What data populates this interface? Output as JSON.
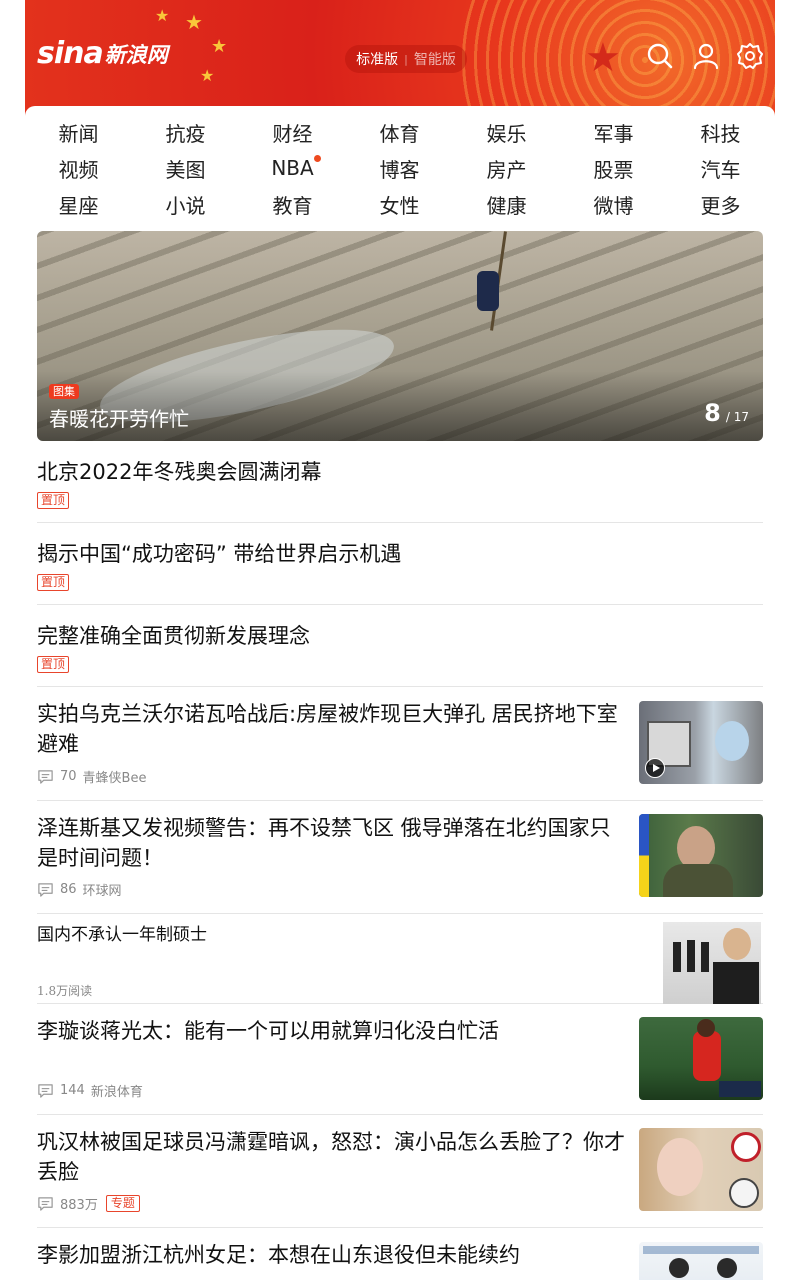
{
  "header": {
    "logo_text": "sina",
    "logo_cn": "新浪网",
    "mode_standard": "标准版",
    "mode_smart": "智能版",
    "icons": [
      "search-icon",
      "user-icon",
      "settings-icon"
    ]
  },
  "channels": [
    {
      "label": "新闻"
    },
    {
      "label": "抗疫"
    },
    {
      "label": "财经"
    },
    {
      "label": "体育"
    },
    {
      "label": "娱乐"
    },
    {
      "label": "军事"
    },
    {
      "label": "科技"
    },
    {
      "label": "视频"
    },
    {
      "label": "美图"
    },
    {
      "label": "NBA",
      "dot": true
    },
    {
      "label": "博客"
    },
    {
      "label": "房产"
    },
    {
      "label": "股票"
    },
    {
      "label": "汽车"
    },
    {
      "label": "星座"
    },
    {
      "label": "小说"
    },
    {
      "label": "教育"
    },
    {
      "label": "女性"
    },
    {
      "label": "健康"
    },
    {
      "label": "微博"
    },
    {
      "label": "更多"
    }
  ],
  "hero": {
    "tag": "图集",
    "caption": "春暖花开劳作忙",
    "current": "8",
    "total": "/ 17"
  },
  "pinned": [
    {
      "title": "北京2022年冬残奥会圆满闭幕",
      "badge": "置顶"
    },
    {
      "title": "揭示中国“成功密码” 带给世界启示机遇",
      "badge": "置顶"
    },
    {
      "title": "完整准确全面贯彻新发展理念",
      "badge": "置顶"
    }
  ],
  "news": [
    {
      "title": "实拍乌克兰沃尔诺瓦哈战后:房屋被炸现巨大弹孔 居民挤地下室避难",
      "comments": "70",
      "source": "青蜂侠Bee",
      "video": true
    },
    {
      "title": "泽连斯基又发视频警告：再不设禁飞区 俄导弹落在北约国家只是时间问题！",
      "comments": "86",
      "source": "环球网"
    },
    {
      "title": "国内不承认一年制硕士",
      "reads": "1.8万阅读"
    },
    {
      "title": "李璇谈蒋光太：能有一个可以用就算归化没白忙活",
      "comments": "144",
      "source": "新浪体育"
    },
    {
      "title": "巩汉林被国足球员冯潇霆暗讽，怒怼：演小品怎么丢脸了？你才丢脸",
      "comments": "883万",
      "topic": "专题"
    },
    {
      "title": "李影加盟浙江杭州女足：本想在山东退役但未能续约"
    }
  ],
  "colors": {
    "brand_red": "#e3321c",
    "accent": "#e8452c"
  }
}
